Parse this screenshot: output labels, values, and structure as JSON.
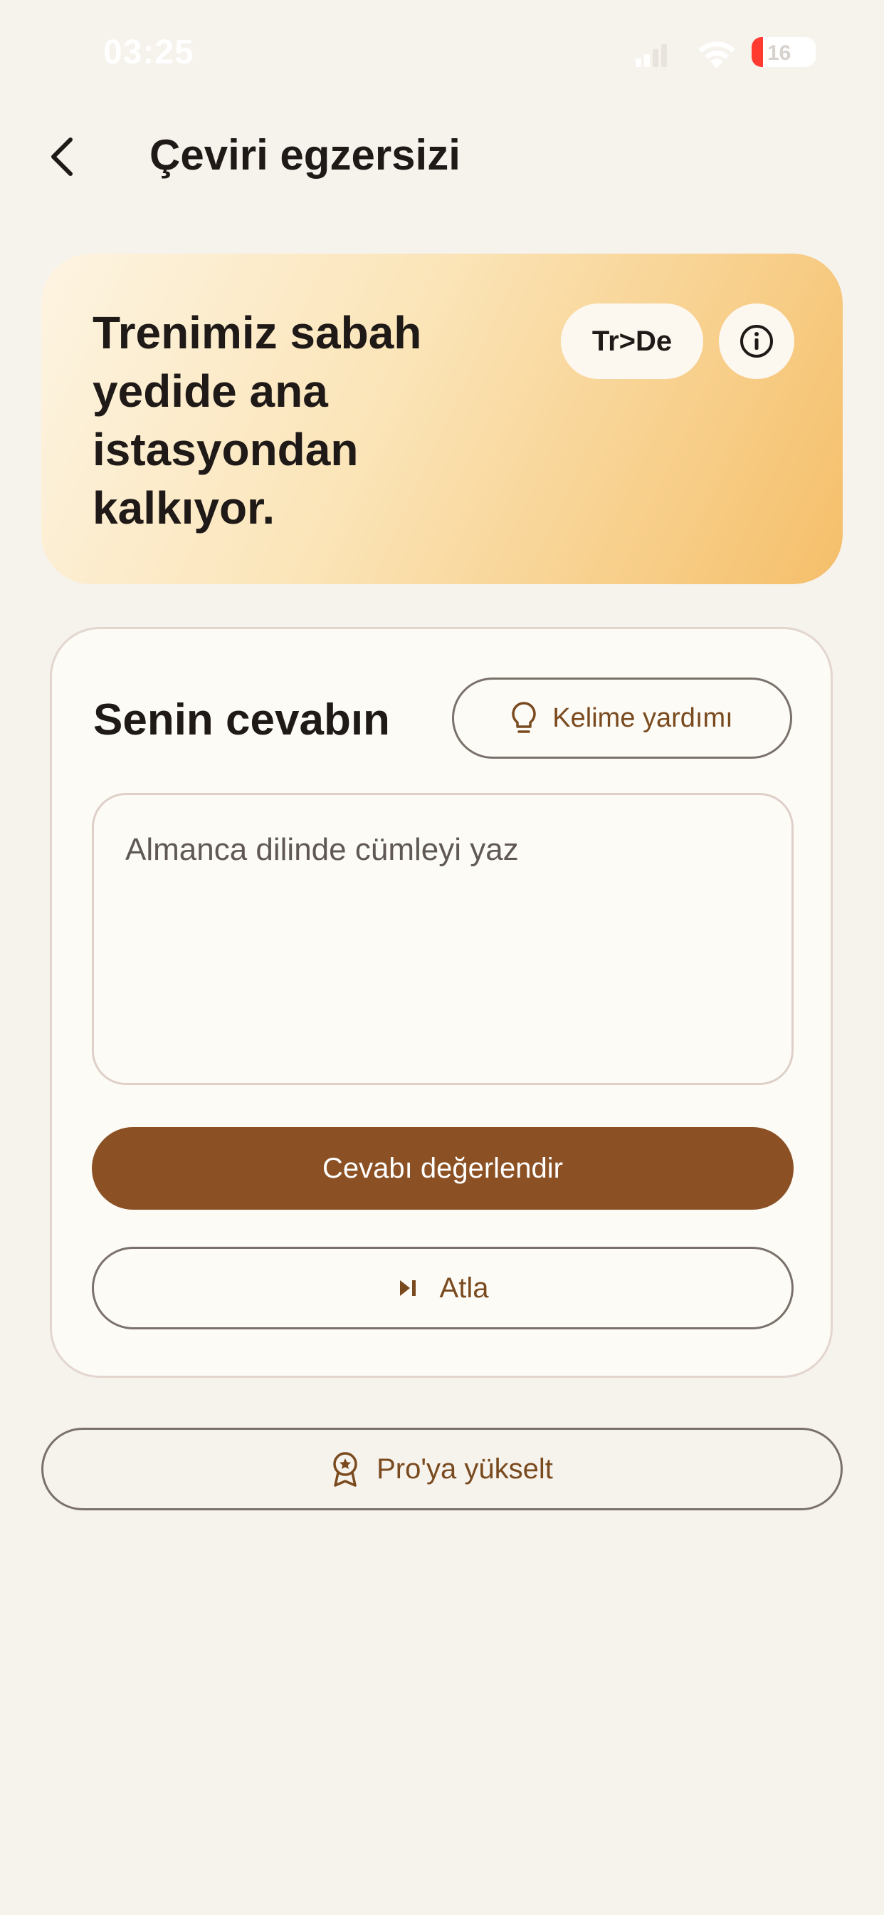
{
  "status_bar": {
    "time": "03:25",
    "battery": "16"
  },
  "header": {
    "back_icon": "chevron-left-icon",
    "title": "Çeviri egzersizi"
  },
  "sentence_card": {
    "sentence": "Trenimiz sabah yedide ana istasyondan kalkıyor.",
    "language_pair": "Tr>De",
    "info_icon": "info-icon"
  },
  "answer": {
    "heading": "Senin cevabın",
    "hint_label": "Kelime yardımı",
    "hint_icon": "lightbulb-icon",
    "input_placeholder": "Almanca dilinde cümleyi yaz",
    "input_value": "",
    "evaluate_label": "Cevabı değerlendir",
    "skip_label": "Atla",
    "skip_icon": "skip-next-icon"
  },
  "upgrade": {
    "label": "Pro'ya yükselt",
    "icon": "award-badge-icon"
  },
  "colors": {
    "background": "#f6f2ec",
    "accent_brown": "#8b5023",
    "text_brown": "#7a4a1f",
    "gradient_end": "#f5bf6a",
    "battery_red": "#ff3b30"
  }
}
